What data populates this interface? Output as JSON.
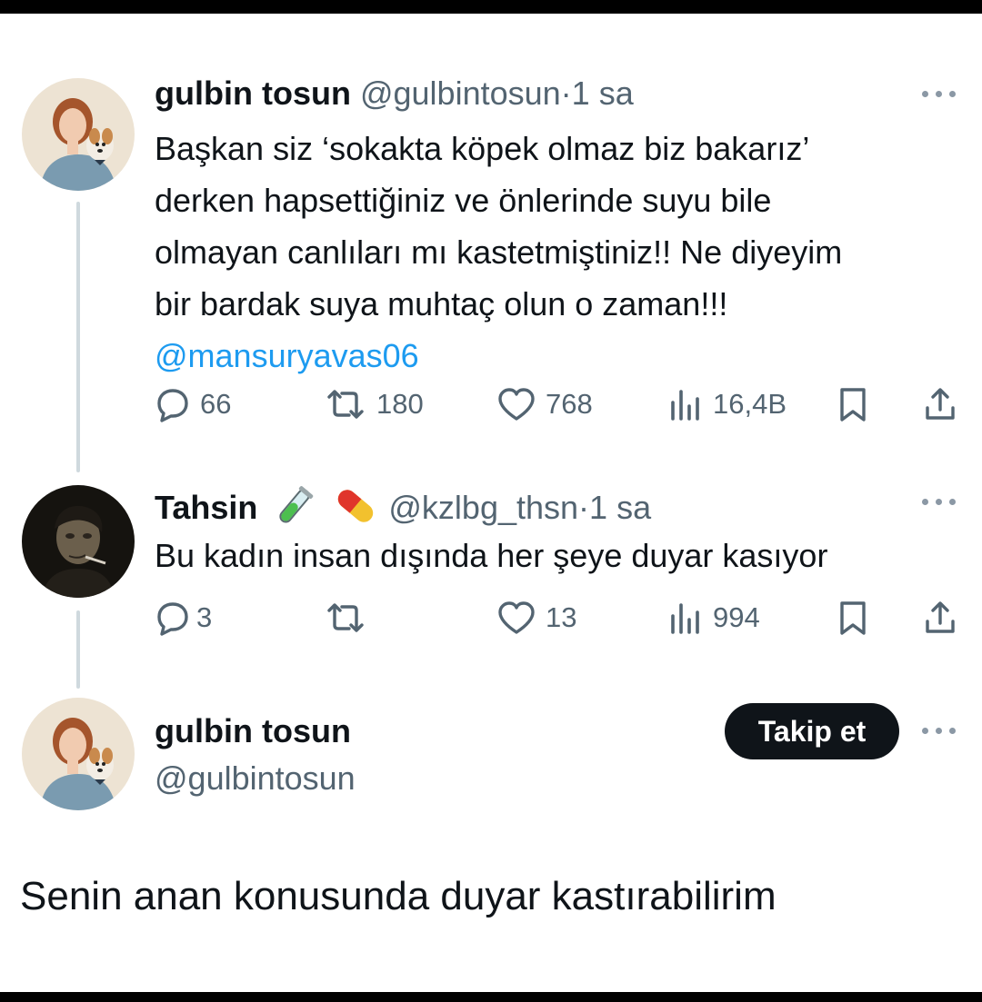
{
  "tweet1": {
    "author_name": "gulbin tosun",
    "author_handle": "@gulbintosun",
    "separator": "·",
    "time": "1 sa",
    "lines": [
      "Başkan siz ‘sokakta köpek olmaz biz bakarız’",
      "derken hapsettiğiniz ve önlerinde suyu bile",
      "olmayan canlıları mı kastetmiştiniz!!  Ne diyeyim",
      "bir bardak suya muhtaç olun o zaman!!!"
    ],
    "mention": "@mansuryavas06",
    "stats": {
      "replies": "66",
      "reposts": "180",
      "likes": "768",
      "views": "16,4B"
    }
  },
  "tweet2": {
    "author_name": "Tahsin",
    "author_emojis": [
      "test-tube-icon",
      "pill-icon"
    ],
    "author_handle": "@kzlbg_thsn",
    "separator": "·",
    "time": "1 sa",
    "text": "Bu kadın insan dışında her şeye duyar kasıyor",
    "stats": {
      "replies": "3",
      "reposts": "",
      "likes": "13",
      "views": "994"
    }
  },
  "tweet3": {
    "author_name": "gulbin tosun",
    "author_handle": "@gulbintosun",
    "follow_label": "Takip et",
    "text": "Senin anan konusunda duyar kastırabilirim"
  },
  "colors": {
    "text": "#0f1419",
    "secondary": "#536471",
    "link": "#1d9bf0",
    "thread_line": "#cfd9de"
  }
}
